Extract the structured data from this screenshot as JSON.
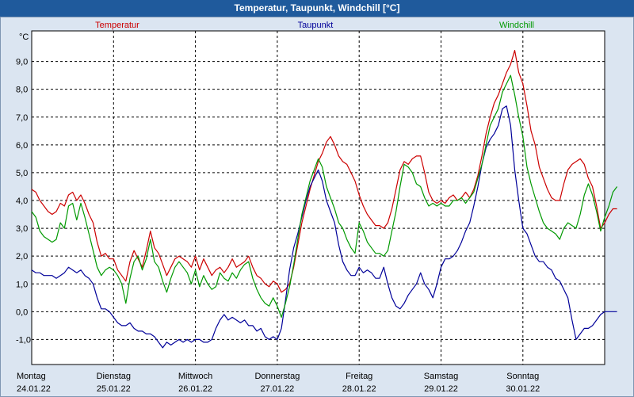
{
  "window": {
    "title": "Temperatur, Taupunkt, Windchill [°C]"
  },
  "chart_data": {
    "type": "line",
    "title": "Temperatur, Taupunkt, Windchill [°C]",
    "ylabel": "°C",
    "ylim": [
      -1.9,
      10.1
    ],
    "grid": true,
    "y_ticks": [
      "9,0",
      "8,0",
      "7,0",
      "6,0",
      "5,0",
      "4,0",
      "3,0",
      "2,0",
      "1,0",
      "0,0",
      "-1,0"
    ],
    "days": [
      {
        "name": "Montag",
        "date": "24.01.22"
      },
      {
        "name": "Dienstag",
        "date": "25.01.22"
      },
      {
        "name": "Mittwoch",
        "date": "26.01.22"
      },
      {
        "name": "Donnerstag",
        "date": "27.01.22"
      },
      {
        "name": "Freitag",
        "date": "28.01.22"
      },
      {
        "name": "Samstag",
        "date": "29.01.22"
      },
      {
        "name": "Sonntag",
        "date": "30.01.22"
      }
    ],
    "x": [
      0,
      0.05,
      0.1,
      0.15,
      0.2,
      0.25,
      0.3,
      0.35,
      0.4,
      0.45,
      0.5,
      0.55,
      0.6,
      0.65,
      0.7,
      0.75,
      0.8,
      0.85,
      0.9,
      0.95,
      1.0,
      1.05,
      1.1,
      1.15,
      1.2,
      1.25,
      1.3,
      1.35,
      1.4,
      1.45,
      1.5,
      1.55,
      1.6,
      1.65,
      1.7,
      1.75,
      1.8,
      1.85,
      1.9,
      1.95,
      2.0,
      2.05,
      2.1,
      2.15,
      2.2,
      2.25,
      2.3,
      2.35,
      2.4,
      2.45,
      2.5,
      2.55,
      2.6,
      2.65,
      2.7,
      2.75,
      2.8,
      2.85,
      2.9,
      2.95,
      3.0,
      3.05,
      3.1,
      3.15,
      3.2,
      3.25,
      3.3,
      3.35,
      3.4,
      3.45,
      3.5,
      3.55,
      3.6,
      3.65,
      3.7,
      3.75,
      3.8,
      3.85,
      3.9,
      3.95,
      4.0,
      4.05,
      4.1,
      4.15,
      4.2,
      4.25,
      4.3,
      4.35,
      4.4,
      4.45,
      4.5,
      4.55,
      4.6,
      4.65,
      4.7,
      4.75,
      4.8,
      4.85,
      4.9,
      4.95,
      5.0,
      5.05,
      5.1,
      5.15,
      5.2,
      5.25,
      5.3,
      5.35,
      5.4,
      5.45,
      5.5,
      5.55,
      5.6,
      5.65,
      5.7,
      5.75,
      5.8,
      5.85,
      5.9,
      5.95,
      6.0,
      6.05,
      6.1,
      6.15,
      6.2,
      6.25,
      6.3,
      6.35,
      6.4,
      6.45,
      6.5,
      6.55,
      6.6,
      6.65,
      6.7,
      6.75,
      6.8,
      6.85,
      6.9,
      6.95,
      7.0,
      7.05,
      7.1,
      7.15
    ],
    "series": [
      {
        "name": "Temperatur",
        "color": "#cc0000",
        "values": [
          4.4,
          4.3,
          4.0,
          3.8,
          3.6,
          3.5,
          3.6,
          3.9,
          3.8,
          4.2,
          4.3,
          4.0,
          4.2,
          3.9,
          3.5,
          3.2,
          2.5,
          2.0,
          2.1,
          1.9,
          1.9,
          1.5,
          1.3,
          1.1,
          1.8,
          2.2,
          1.9,
          1.6,
          2.2,
          2.9,
          2.3,
          2.1,
          1.7,
          1.3,
          1.6,
          1.9,
          2.0,
          1.9,
          1.8,
          1.6,
          2.0,
          1.5,
          1.9,
          1.6,
          1.3,
          1.5,
          1.6,
          1.4,
          1.6,
          1.9,
          1.6,
          1.7,
          1.8,
          2.0,
          1.6,
          1.3,
          1.2,
          1.0,
          0.9,
          1.1,
          1.0,
          0.7,
          0.8,
          1.0,
          1.6,
          2.4,
          3.2,
          3.8,
          4.4,
          4.9,
          5.4,
          5.7,
          6.1,
          6.3,
          6.0,
          5.6,
          5.4,
          5.3,
          5.0,
          4.7,
          4.2,
          3.8,
          3.5,
          3.3,
          3.1,
          3.1,
          3.0,
          3.2,
          3.7,
          4.4,
          5.1,
          5.4,
          5.3,
          5.5,
          5.6,
          5.6,
          5.0,
          4.3,
          4.0,
          3.9,
          4.0,
          3.9,
          4.1,
          4.2,
          4.0,
          4.1,
          4.3,
          4.1,
          4.4,
          4.9,
          5.6,
          6.4,
          7.0,
          7.5,
          7.8,
          8.2,
          8.6,
          8.9,
          9.4,
          8.6,
          8.2,
          7.4,
          6.5,
          6.0,
          5.2,
          4.8,
          4.4,
          4.1,
          4.0,
          4.0,
          4.6,
          5.1,
          5.3,
          5.4,
          5.5,
          5.3,
          4.8,
          4.5,
          3.8,
          3.0,
          3.2,
          3.5,
          3.7,
          3.7
        ]
      },
      {
        "name": "Taupunkt",
        "color": "#000099",
        "values": [
          1.5,
          1.4,
          1.4,
          1.3,
          1.3,
          1.3,
          1.2,
          1.3,
          1.4,
          1.6,
          1.5,
          1.4,
          1.5,
          1.3,
          1.2,
          1.0,
          0.5,
          0.1,
          0.1,
          0.0,
          -0.2,
          -0.4,
          -0.5,
          -0.5,
          -0.4,
          -0.6,
          -0.7,
          -0.7,
          -0.8,
          -0.8,
          -0.9,
          -1.1,
          -1.3,
          -1.1,
          -1.2,
          -1.1,
          -1.0,
          -1.1,
          -1.0,
          -1.1,
          -1.0,
          -1.0,
          -1.1,
          -1.1,
          -1.0,
          -0.6,
          -0.3,
          -0.1,
          -0.3,
          -0.2,
          -0.3,
          -0.4,
          -0.3,
          -0.5,
          -0.5,
          -0.7,
          -0.6,
          -0.9,
          -1.0,
          -0.9,
          -1.0,
          -0.6,
          0.4,
          1.5,
          2.3,
          2.8,
          3.4,
          4.0,
          4.5,
          4.8,
          5.1,
          4.7,
          4.0,
          3.6,
          3.2,
          2.4,
          1.8,
          1.5,
          1.3,
          1.3,
          1.6,
          1.4,
          1.5,
          1.4,
          1.2,
          1.2,
          1.6,
          1.0,
          0.5,
          0.2,
          0.1,
          0.3,
          0.6,
          0.8,
          1.0,
          1.4,
          1.0,
          0.8,
          0.5,
          1.0,
          1.6,
          1.9,
          1.9,
          2.0,
          2.2,
          2.5,
          2.9,
          3.2,
          3.8,
          4.5,
          5.3,
          5.9,
          6.2,
          6.4,
          6.7,
          7.3,
          7.4,
          6.7,
          5.1,
          4.0,
          3.0,
          2.8,
          2.4,
          2.0,
          1.8,
          1.8,
          1.6,
          1.5,
          1.2,
          1.1,
          0.8,
          0.5,
          -0.3,
          -1.0,
          -0.8,
          -0.6,
          -0.6,
          -0.5,
          -0.3,
          -0.1,
          0.0,
          0.0,
          0.0,
          0.0
        ]
      },
      {
        "name": "Windchill",
        "color": "#009900",
        "values": [
          3.6,
          3.4,
          2.9,
          2.7,
          2.6,
          2.5,
          2.6,
          3.2,
          3.0,
          3.8,
          3.9,
          3.3,
          3.9,
          3.4,
          2.8,
          2.2,
          1.6,
          1.3,
          1.5,
          1.6,
          1.5,
          1.3,
          1.0,
          0.3,
          1.2,
          1.8,
          2.0,
          1.5,
          1.9,
          2.6,
          1.8,
          1.6,
          1.1,
          0.7,
          1.2,
          1.6,
          1.8,
          1.6,
          1.4,
          1.0,
          1.5,
          0.9,
          1.3,
          1.0,
          0.8,
          0.9,
          1.4,
          1.2,
          1.1,
          1.4,
          1.2,
          1.5,
          1.7,
          1.8,
          1.2,
          0.8,
          0.5,
          0.3,
          0.2,
          0.5,
          0.2,
          -0.2,
          0.3,
          0.9,
          1.7,
          2.6,
          3.5,
          4.1,
          4.7,
          5.1,
          5.5,
          5.2,
          4.5,
          4.1,
          3.7,
          3.2,
          3.0,
          2.6,
          2.3,
          2.1,
          3.2,
          2.9,
          2.5,
          2.3,
          2.1,
          2.1,
          2.0,
          2.2,
          2.9,
          3.6,
          4.5,
          5.3,
          5.2,
          5.0,
          4.6,
          4.5,
          4.1,
          3.8,
          3.9,
          3.8,
          3.9,
          3.8,
          3.8,
          4.0,
          4.0,
          4.1,
          3.9,
          4.1,
          4.3,
          4.8,
          5.3,
          6.0,
          6.7,
          7.0,
          7.3,
          7.9,
          8.2,
          8.5,
          7.8,
          7.0,
          6.3,
          5.2,
          4.6,
          4.1,
          3.6,
          3.2,
          3.0,
          2.9,
          2.8,
          2.6,
          3.0,
          3.2,
          3.1,
          3.0,
          3.5,
          4.2,
          4.6,
          4.2,
          3.6,
          2.9,
          3.4,
          3.8,
          4.3,
          4.5
        ]
      }
    ]
  }
}
